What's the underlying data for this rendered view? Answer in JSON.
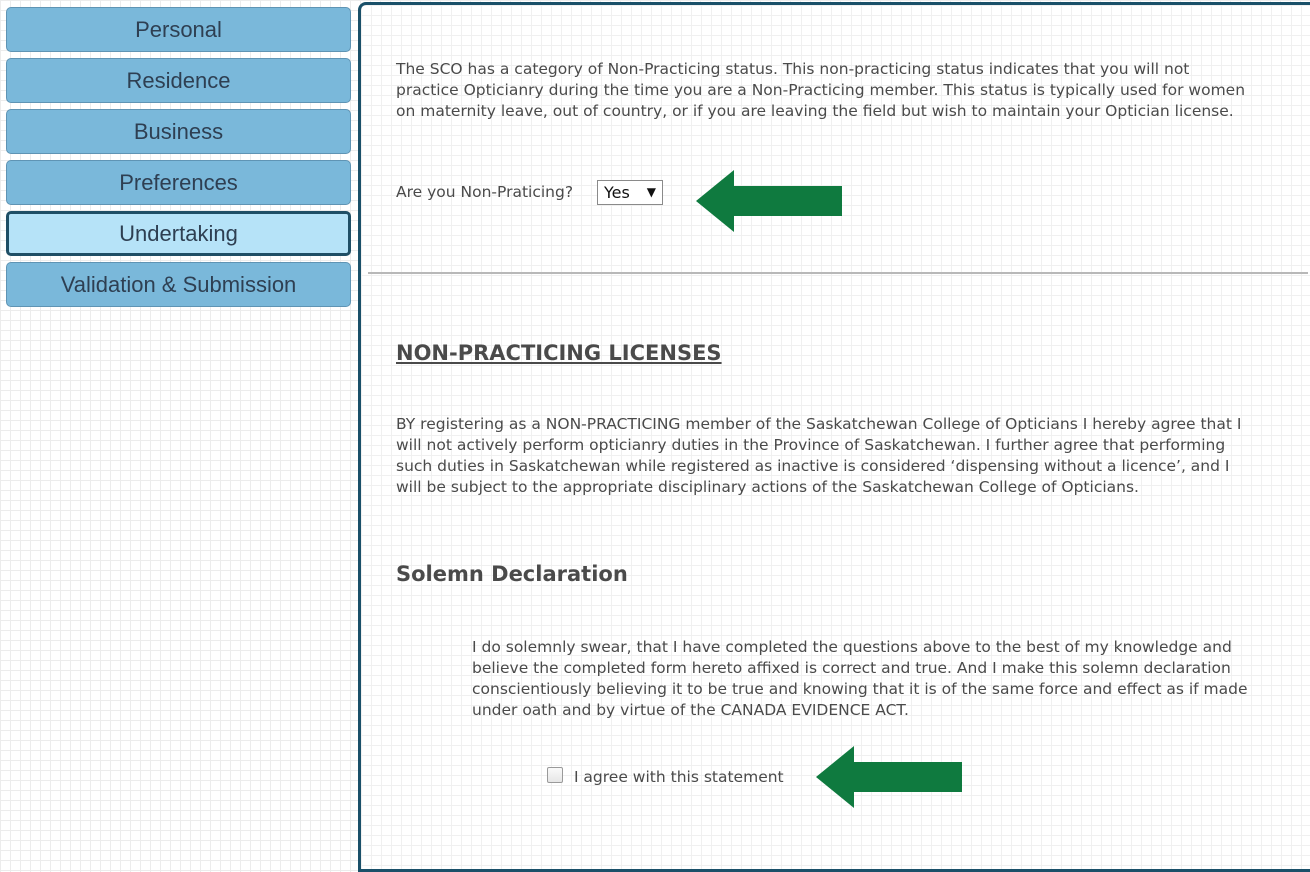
{
  "sidebar": {
    "items": [
      {
        "label": "Personal"
      },
      {
        "label": "Residence"
      },
      {
        "label": "Business"
      },
      {
        "label": "Preferences"
      },
      {
        "label": "Undertaking",
        "active": true
      },
      {
        "label": "Validation & Submission"
      }
    ]
  },
  "main": {
    "intro_text": "The SCO has a category of Non-Practicing status. This non-practicing status indicates that you will not practice Opticianry during the time you are a Non-Practicing member. This status is typically used for women on maternity leave, out of country, or if you are leaving the field but wish to maintain your Optician license.",
    "question_label": "Are you Non-Praticing?",
    "question_selected": "Yes",
    "section1_heading": "NON-PRACTICING LICENSES",
    "section1_text": "BY registering as a NON-PRACTICING member of the Saskatchewan College of Opticians I hereby agree that I will not actively perform opticianry duties in the Province of Saskatchewan. I further agree that performing such duties in Saskatchewan while registered as inactive is considered ‘dispensing without a licence’, and I will be subject to the appropriate disciplinary actions of the Saskatchewan College of Opticians.",
    "section2_heading": "Solemn Declaration",
    "declaration_text": "I do solemnly swear, that I have completed the questions above to the best of my knowledge and believe the completed form hereto affixed is correct and true. And I make this solemn declaration conscientiously believing it to be true and knowing that it is of the same force and effect as if made under oath and by virtue of the CANADA EVIDENCE ACT.",
    "agree_label": "I agree with this statement",
    "agree_checked": false
  },
  "colors": {
    "nav_bg": "#7ab8da",
    "nav_active_bg": "#b6e3f8",
    "panel_border": "#1a5069",
    "arrow": "#0f7a3f"
  }
}
